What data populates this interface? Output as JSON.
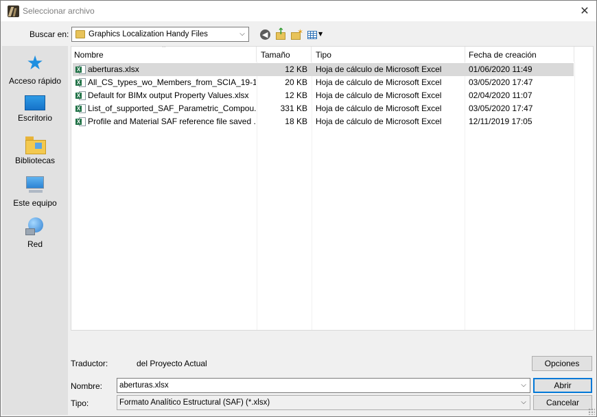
{
  "window": {
    "title": "Seleccionar archivo"
  },
  "lookin": {
    "label": "Buscar en:",
    "value": "Graphics Localization Handy Files"
  },
  "places": [
    {
      "label": "Acceso rápido",
      "icon": "quick-access-star-icon"
    },
    {
      "label": "Escritorio",
      "icon": "desktop-icon"
    },
    {
      "label": "Bibliotecas",
      "icon": "libraries-icon"
    },
    {
      "label": "Este equipo",
      "icon": "this-pc-icon"
    },
    {
      "label": "Red",
      "icon": "network-icon"
    }
  ],
  "columns": {
    "name": "Nombre",
    "size": "Tamaño",
    "type": "Tipo",
    "created": "Fecha de creación"
  },
  "files": [
    {
      "name": "aberturas.xlsx",
      "size": "12 KB",
      "type": "Hoja de cálculo de Microsoft Excel",
      "created": "01/06/2020 11:49",
      "selected": true
    },
    {
      "name": "All_CS_types_wo_Members_from_SCIA_19-1...",
      "size": "20 KB",
      "type": "Hoja de cálculo de Microsoft Excel",
      "created": "03/05/2020 17:47"
    },
    {
      "name": "Default for BIMx output Property Values.xlsx",
      "size": "12 KB",
      "type": "Hoja de cálculo de Microsoft Excel",
      "created": "02/04/2020 11:07"
    },
    {
      "name": "List_of_supported_SAF_Parametric_Compou...",
      "size": "331 KB",
      "type": "Hoja de cálculo de Microsoft Excel",
      "created": "03/05/2020 17:47"
    },
    {
      "name": "Profile and Material SAF reference file saved ...",
      "size": "18 KB",
      "type": "Hoja de cálculo de Microsoft Excel",
      "created": "12/11/2019 17:05"
    }
  ],
  "translator": {
    "label": "Traductor:",
    "value": "del Proyecto Actual"
  },
  "options_button": "Opciones",
  "filename": {
    "label": "Nombre:",
    "value": "aberturas.xlsx"
  },
  "filetype": {
    "label": "Tipo:",
    "value": "Formato Analítico Estructural (SAF) (*.xlsx)"
  },
  "open_button": "Abrir",
  "cancel_button": "Cancelar",
  "colors": {
    "selected_row": "#d9d9d9",
    "primary_border": "#0078d7",
    "excel_green": "#1d7044"
  }
}
